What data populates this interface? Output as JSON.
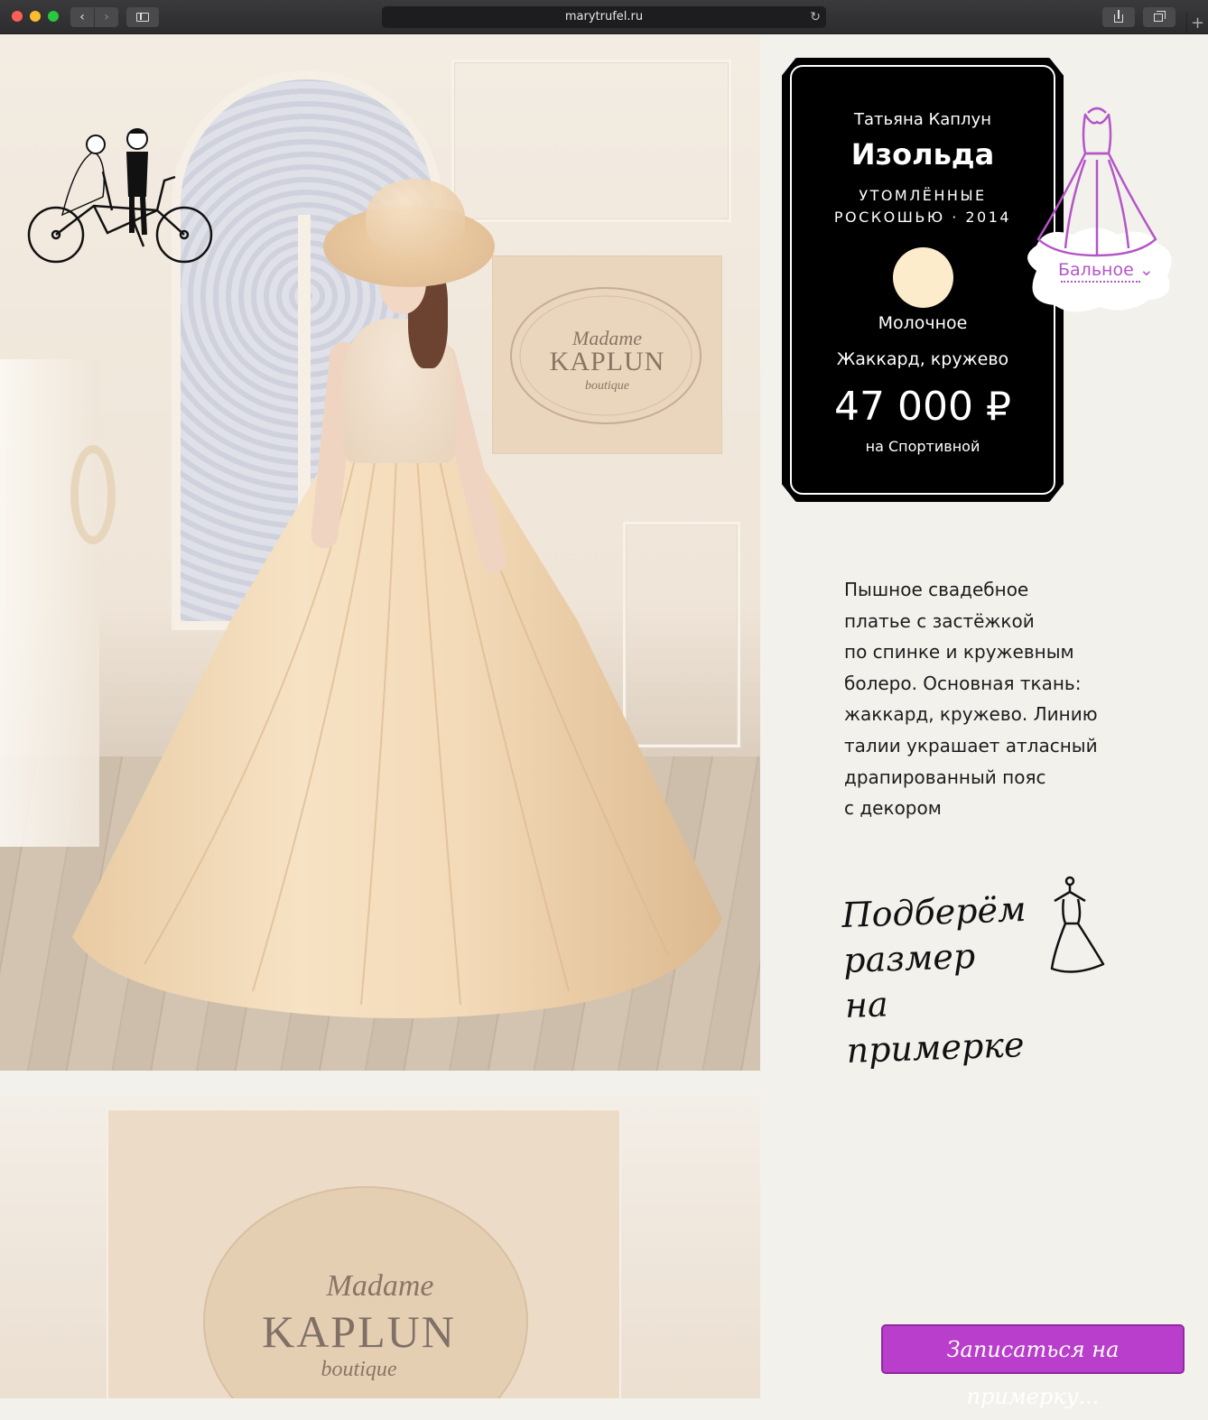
{
  "browser": {
    "url": "marytrufel.ru",
    "back_glyph": "‹",
    "forward_glyph": "›",
    "reload_glyph": "↻",
    "newtab_glyph": "+"
  },
  "hero_image": {
    "sign_script": "Madame",
    "sign_brand": "KAPLUN",
    "sign_sub": "boutique"
  },
  "second_image": {
    "sign_script": "Madame",
    "sign_brand": "KAPLUN",
    "sign_sub": "boutique"
  },
  "card": {
    "designer": "Татьяна Каплун",
    "name": "Изольда",
    "collection_line1": "УТОМЛЁННЫЕ",
    "collection_line2": "РОСКОШЬЮ · 2014",
    "swatch_color": "#fdeccb",
    "color_name": "Молочное",
    "fabric": "Жаккард, кружево",
    "price": "47 000 ₽",
    "location": "на Спортивной"
  },
  "silhouette": {
    "label": "Бальное",
    "chevron": "⌄",
    "accent": "#b455c8"
  },
  "description": [
    "Пышное свадебное",
    "платье с застёжкой",
    "по спинке и кружевным",
    "болеро. Основная ткань:",
    "жаккард, кружево. Линию",
    "талии украшает атласный",
    "драпированный пояс",
    "с декором"
  ],
  "size_note": {
    "line1": "Подберём",
    "line2": "размер",
    "line3": "на примерке"
  },
  "cta": {
    "label": "Записаться на примерку...",
    "color": "#b93ecb"
  }
}
